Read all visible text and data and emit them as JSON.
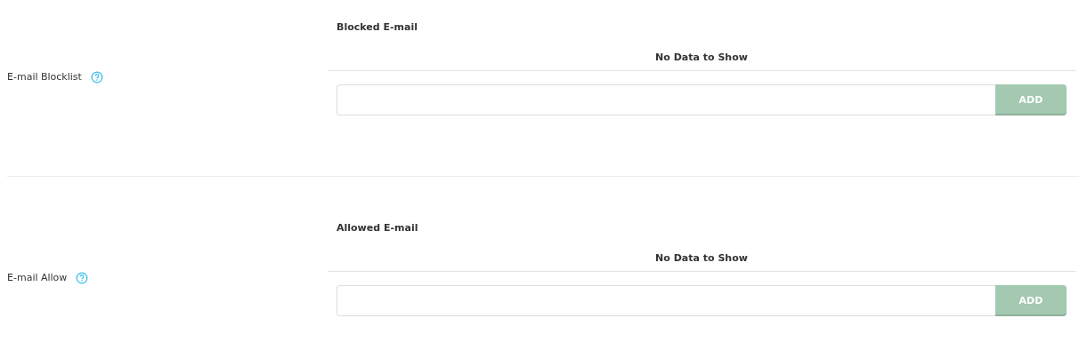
{
  "sections": [
    {
      "label": "E-mail Blocklist",
      "list_header": "Blocked E-mail",
      "empty_text": "No Data to Show",
      "button": {
        "label": "ADD",
        "disabled": true
      }
    },
    {
      "label": "E-mail Allow",
      "list_header": "Allowed E-mail",
      "empty_text": "No Data to Show",
      "button": {
        "label": "ADD",
        "disabled": true
      }
    }
  ]
}
